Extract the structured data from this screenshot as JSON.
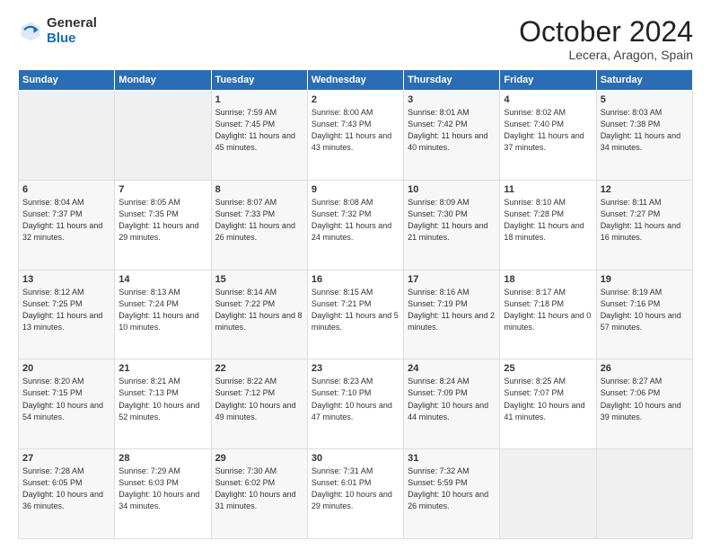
{
  "logo": {
    "general": "General",
    "blue": "Blue"
  },
  "header": {
    "month": "October 2024",
    "location": "Lecera, Aragon, Spain"
  },
  "weekdays": [
    "Sunday",
    "Monday",
    "Tuesday",
    "Wednesday",
    "Thursday",
    "Friday",
    "Saturday"
  ],
  "weeks": [
    [
      {
        "day": "",
        "info": ""
      },
      {
        "day": "",
        "info": ""
      },
      {
        "day": "1",
        "info": "Sunrise: 7:59 AM\nSunset: 7:45 PM\nDaylight: 11 hours and 45 minutes."
      },
      {
        "day": "2",
        "info": "Sunrise: 8:00 AM\nSunset: 7:43 PM\nDaylight: 11 hours and 43 minutes."
      },
      {
        "day": "3",
        "info": "Sunrise: 8:01 AM\nSunset: 7:42 PM\nDaylight: 11 hours and 40 minutes."
      },
      {
        "day": "4",
        "info": "Sunrise: 8:02 AM\nSunset: 7:40 PM\nDaylight: 11 hours and 37 minutes."
      },
      {
        "day": "5",
        "info": "Sunrise: 8:03 AM\nSunset: 7:38 PM\nDaylight: 11 hours and 34 minutes."
      }
    ],
    [
      {
        "day": "6",
        "info": "Sunrise: 8:04 AM\nSunset: 7:37 PM\nDaylight: 11 hours and 32 minutes."
      },
      {
        "day": "7",
        "info": "Sunrise: 8:05 AM\nSunset: 7:35 PM\nDaylight: 11 hours and 29 minutes."
      },
      {
        "day": "8",
        "info": "Sunrise: 8:07 AM\nSunset: 7:33 PM\nDaylight: 11 hours and 26 minutes."
      },
      {
        "day": "9",
        "info": "Sunrise: 8:08 AM\nSunset: 7:32 PM\nDaylight: 11 hours and 24 minutes."
      },
      {
        "day": "10",
        "info": "Sunrise: 8:09 AM\nSunset: 7:30 PM\nDaylight: 11 hours and 21 minutes."
      },
      {
        "day": "11",
        "info": "Sunrise: 8:10 AM\nSunset: 7:28 PM\nDaylight: 11 hours and 18 minutes."
      },
      {
        "day": "12",
        "info": "Sunrise: 8:11 AM\nSunset: 7:27 PM\nDaylight: 11 hours and 16 minutes."
      }
    ],
    [
      {
        "day": "13",
        "info": "Sunrise: 8:12 AM\nSunset: 7:25 PM\nDaylight: 11 hours and 13 minutes."
      },
      {
        "day": "14",
        "info": "Sunrise: 8:13 AM\nSunset: 7:24 PM\nDaylight: 11 hours and 10 minutes."
      },
      {
        "day": "15",
        "info": "Sunrise: 8:14 AM\nSunset: 7:22 PM\nDaylight: 11 hours and 8 minutes."
      },
      {
        "day": "16",
        "info": "Sunrise: 8:15 AM\nSunset: 7:21 PM\nDaylight: 11 hours and 5 minutes."
      },
      {
        "day": "17",
        "info": "Sunrise: 8:16 AM\nSunset: 7:19 PM\nDaylight: 11 hours and 2 minutes."
      },
      {
        "day": "18",
        "info": "Sunrise: 8:17 AM\nSunset: 7:18 PM\nDaylight: 11 hours and 0 minutes."
      },
      {
        "day": "19",
        "info": "Sunrise: 8:19 AM\nSunset: 7:16 PM\nDaylight: 10 hours and 57 minutes."
      }
    ],
    [
      {
        "day": "20",
        "info": "Sunrise: 8:20 AM\nSunset: 7:15 PM\nDaylight: 10 hours and 54 minutes."
      },
      {
        "day": "21",
        "info": "Sunrise: 8:21 AM\nSunset: 7:13 PM\nDaylight: 10 hours and 52 minutes."
      },
      {
        "day": "22",
        "info": "Sunrise: 8:22 AM\nSunset: 7:12 PM\nDaylight: 10 hours and 49 minutes."
      },
      {
        "day": "23",
        "info": "Sunrise: 8:23 AM\nSunset: 7:10 PM\nDaylight: 10 hours and 47 minutes."
      },
      {
        "day": "24",
        "info": "Sunrise: 8:24 AM\nSunset: 7:09 PM\nDaylight: 10 hours and 44 minutes."
      },
      {
        "day": "25",
        "info": "Sunrise: 8:25 AM\nSunset: 7:07 PM\nDaylight: 10 hours and 41 minutes."
      },
      {
        "day": "26",
        "info": "Sunrise: 8:27 AM\nSunset: 7:06 PM\nDaylight: 10 hours and 39 minutes."
      }
    ],
    [
      {
        "day": "27",
        "info": "Sunrise: 7:28 AM\nSunset: 6:05 PM\nDaylight: 10 hours and 36 minutes."
      },
      {
        "day": "28",
        "info": "Sunrise: 7:29 AM\nSunset: 6:03 PM\nDaylight: 10 hours and 34 minutes."
      },
      {
        "day": "29",
        "info": "Sunrise: 7:30 AM\nSunset: 6:02 PM\nDaylight: 10 hours and 31 minutes."
      },
      {
        "day": "30",
        "info": "Sunrise: 7:31 AM\nSunset: 6:01 PM\nDaylight: 10 hours and 29 minutes."
      },
      {
        "day": "31",
        "info": "Sunrise: 7:32 AM\nSunset: 5:59 PM\nDaylight: 10 hours and 26 minutes."
      },
      {
        "day": "",
        "info": ""
      },
      {
        "day": "",
        "info": ""
      }
    ]
  ]
}
